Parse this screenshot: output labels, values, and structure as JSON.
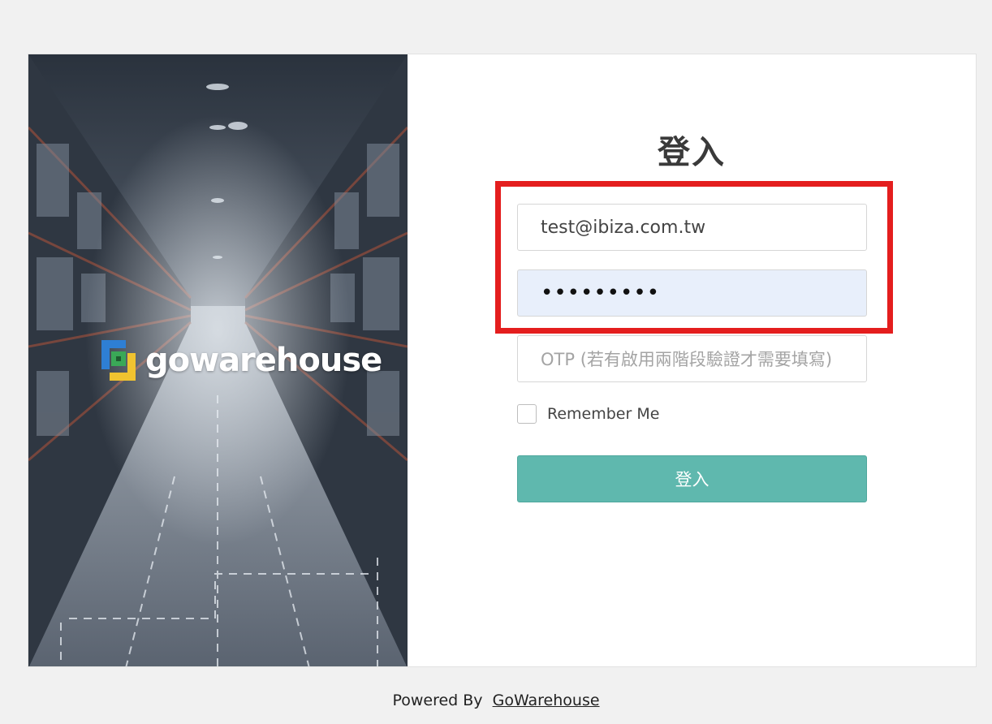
{
  "hero": {
    "brand_name": "gowarehouse",
    "logo_icon": "gowarehouse-logo-icon"
  },
  "login": {
    "title": "登入",
    "email_value": "test@ibiza.com.tw",
    "password_value": "•••••••••",
    "otp_placeholder": "OTP (若有啟用兩階段驗證才需要填寫)",
    "remember_label": "Remember Me",
    "remember_checked": false,
    "submit_label": "登入"
  },
  "footer": {
    "powered_by": "Powered By",
    "link_text": "GoWarehouse"
  },
  "colors": {
    "accent": "#5fb8ae",
    "highlight": "#e41e1e",
    "autofill_bg": "#e8effb"
  }
}
